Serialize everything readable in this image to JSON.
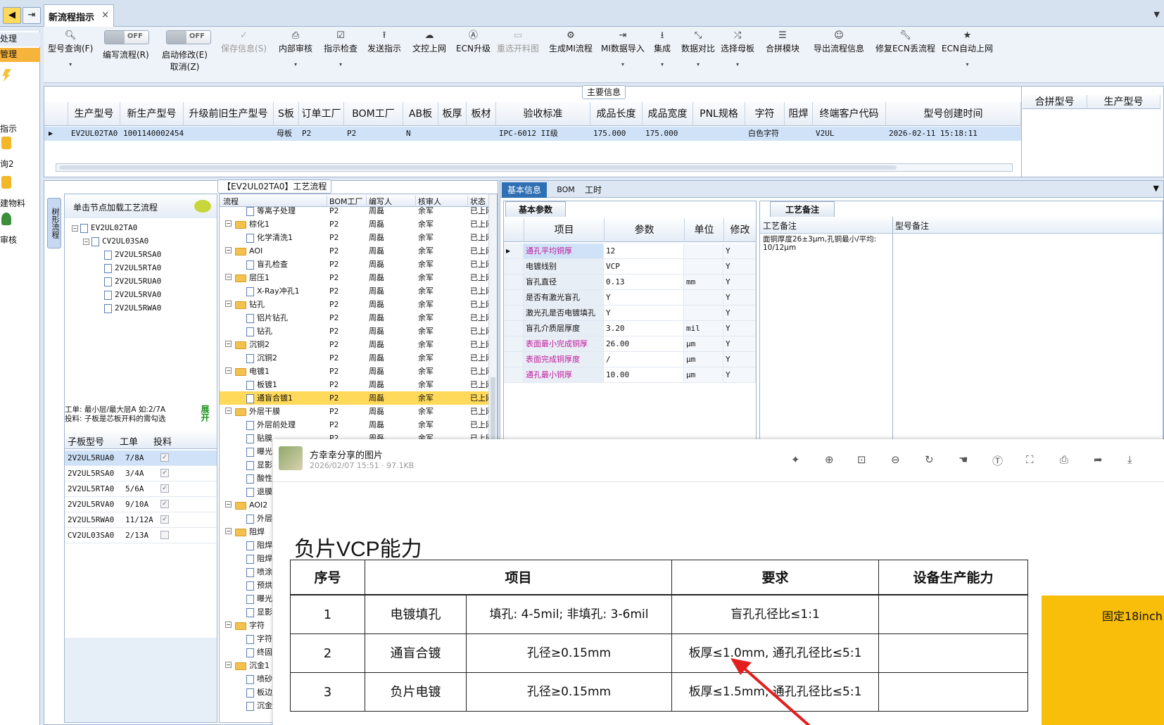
{
  "window": {
    "tab_title": "新流程指示",
    "tab_close": "×",
    "right_arrow": "▼"
  },
  "nav": {
    "back": "◀",
    "forward": "⇥"
  },
  "left_nav": {
    "items": [
      "处理",
      "管理",
      "指示",
      "询2",
      "建物料",
      "审核"
    ]
  },
  "toolbar": {
    "items": [
      {
        "label": "型号查询(F)",
        "icon": "🔍︎",
        "dropdown": "▾"
      },
      {
        "label": "编写流程(R)"
      },
      {
        "label": "启动修改(E)",
        "label2": "取消(Z)"
      },
      {
        "label": "保存信息(S)",
        "icon": "✓"
      },
      {
        "label": "内部审核",
        "icon": "⎙",
        "dropdown": "▾"
      },
      {
        "label": "指示检查",
        "icon": "☑",
        "dropdown": "▾"
      },
      {
        "label": "发送指示",
        "icon": "⭱"
      },
      {
        "label": "文控上网",
        "icon": "☁"
      },
      {
        "label": "ECN升级",
        "icon": "Ⓐ"
      },
      {
        "label": "重选开料图",
        "icon": "▭"
      },
      {
        "label": "生成MI流程",
        "icon": "⚙"
      },
      {
        "label": "MI数据导入",
        "icon": "⇥",
        "dropdown": "▾"
      },
      {
        "label": "集成",
        "icon": "⭳",
        "dropdown": "▾"
      },
      {
        "label": "数据对比",
        "icon": "⤡",
        "dropdown": "▾"
      },
      {
        "label": "选择母板",
        "icon": "⤮",
        "dropdown": "▾"
      },
      {
        "label": "合拼模块",
        "icon": "☰"
      },
      {
        "label": "导出流程信息",
        "icon": "☺"
      },
      {
        "label": "修复ECN丢流程",
        "icon": "🔧︎"
      },
      {
        "label": "ECN自动上网",
        "icon": "★",
        "dropdown": "▾"
      }
    ],
    "toggle_off": "OFF"
  },
  "main_info": {
    "title": "主要信息",
    "headers": [
      "生产型号",
      "新生产型号",
      "升级前旧生产型号",
      "S板",
      "订单工厂",
      "BOM工厂",
      "AB板",
      "板厚",
      "板材",
      "验收标准",
      "成品长度",
      "成品宽度",
      "PNL规格",
      "字符",
      "阻焊",
      "终端客户代码",
      "型号创建时间"
    ],
    "row": [
      "EV2UL02TA0",
      "10011400024549",
      "",
      "母板",
      "P2",
      "P2",
      "N",
      "",
      "",
      "IPC-6012 II级",
      "175.000",
      "175.000",
      "",
      "白色字符",
      "",
      "V2UL",
      "2026-02-11 15:18:11"
    ],
    "side_headers": [
      "合拼型号",
      "生产型号"
    ]
  },
  "process": {
    "title": "【EV2UL02TA0】工艺流程",
    "vertical_tab": "树形流程",
    "tree_header": "单击节点加载工艺流程",
    "tree": [
      "EV2UL02TA0",
      "CV2UL03SA0",
      "2V2UL5RSA0",
      "2V2UL5RTA0",
      "2V2UL5RUA0",
      "2V2UL5RVA0",
      "2V2UL5RWA0"
    ],
    "note1": "工单: 最小层/最大层A 如:2/7A",
    "note2": "投料: 子板是芯板开料的需勾选",
    "expand_btn": "展开",
    "sub_headers": [
      "子板型号",
      "工单",
      "投料"
    ],
    "sub_rows": [
      [
        "2V2UL5RUA0",
        "7/8A",
        true
      ],
      [
        "2V2UL5RSA0",
        "3/4A",
        true
      ],
      [
        "2V2UL5RTA0",
        "5/6A",
        true
      ],
      [
        "2V2UL5RVA0",
        "9/10A",
        true
      ],
      [
        "2V2UL5RWA0",
        "11/12A",
        true
      ],
      [
        "CV2UL03SA0",
        "2/13A",
        false
      ]
    ],
    "flow_headers": [
      "流程",
      "BOM工厂",
      "编写人",
      "核审人",
      "状态"
    ],
    "flow_rows": [
      {
        "name": "等离子处理",
        "level": 1,
        "folder": false
      },
      {
        "name": "棕化1",
        "level": 0,
        "folder": true
      },
      {
        "name": "化学清洗1",
        "level": 1,
        "folder": false
      },
      {
        "name": "AOI",
        "level": 0,
        "folder": true
      },
      {
        "name": "盲孔检查",
        "level": 1,
        "folder": false
      },
      {
        "name": "层压1",
        "level": 0,
        "folder": true
      },
      {
        "name": "X-Ray冲孔1",
        "level": 1,
        "folder": false
      },
      {
        "name": "钻孔",
        "level": 0,
        "folder": true
      },
      {
        "name": "铝片钻孔",
        "level": 1,
        "folder": false
      },
      {
        "name": "钻孔",
        "level": 1,
        "folder": false
      },
      {
        "name": "沉铜2",
        "level": 0,
        "folder": true
      },
      {
        "name": "沉铜2",
        "level": 1,
        "folder": false
      },
      {
        "name": "电镀1",
        "level": 0,
        "folder": true
      },
      {
        "name": "板镀1",
        "level": 1,
        "folder": false
      },
      {
        "name": "通盲合镀1",
        "level": 1,
        "folder": false,
        "selected": true
      },
      {
        "name": "外层干膜",
        "level": 0,
        "folder": true
      },
      {
        "name": "外层前处理",
        "level": 1,
        "folder": false
      },
      {
        "name": "贴膜",
        "level": 1,
        "folder": false
      },
      {
        "name": "曝光",
        "level": 1,
        "folder": false
      },
      {
        "name": "显影",
        "level": 1,
        "folder": false
      },
      {
        "name": "酸性",
        "level": 1,
        "folder": false
      },
      {
        "name": "退膜",
        "level": 1,
        "folder": false
      },
      {
        "name": "AOI2",
        "level": 0,
        "folder": true
      },
      {
        "name": "外层",
        "level": 1,
        "folder": false
      },
      {
        "name": "阻焊",
        "level": 0,
        "folder": true
      },
      {
        "name": "阻焊",
        "level": 1,
        "folder": false
      },
      {
        "name": "阻焊",
        "level": 1,
        "folder": false
      },
      {
        "name": "喷涂",
        "level": 1,
        "folder": false
      },
      {
        "name": "预烘",
        "level": 1,
        "folder": false
      },
      {
        "name": "曝光",
        "level": 1,
        "folder": false
      },
      {
        "name": "显影",
        "level": 1,
        "folder": false
      },
      {
        "name": "字符",
        "level": 0,
        "folder": true
      },
      {
        "name": "字符",
        "level": 1,
        "folder": false
      },
      {
        "name": "终固",
        "level": 1,
        "folder": false
      },
      {
        "name": "沉金1",
        "level": 0,
        "folder": true
      },
      {
        "name": "喷砂",
        "level": 1,
        "folder": false
      },
      {
        "name": "板边",
        "level": 1,
        "folder": false
      },
      {
        "name": "沉金",
        "level": 1,
        "folder": false
      }
    ],
    "flow_factory": "P2",
    "flow_writer": "周磊",
    "flow_reviewer": "余军",
    "flow_status": "已上网"
  },
  "right_tabs": [
    "基本信息",
    "BOM",
    "工时"
  ],
  "basic_params": {
    "tab": "基本参数",
    "headers": [
      "项目",
      "参数",
      "单位",
      "修改"
    ],
    "rows": [
      [
        "通孔平均铜厚",
        "12",
        "",
        "Y",
        true
      ],
      [
        "电镀线别",
        "VCP",
        "",
        "Y",
        false
      ],
      [
        "盲孔直径",
        "0.13",
        "mm",
        "Y",
        false
      ],
      [
        "是否有激光盲孔",
        "Y",
        "",
        "Y",
        false
      ],
      [
        "激光孔是否电镀填孔",
        "Y",
        "",
        "Y",
        false
      ],
      [
        "盲孔介质层厚度",
        "3.20",
        "mil",
        "Y",
        false
      ],
      [
        "表面最小完成铜厚",
        "26.00",
        "μm",
        "Y",
        true
      ],
      [
        "表面完成铜厚度",
        "/",
        "μm",
        "Y",
        true
      ],
      [
        "通孔最小铜厚",
        "10.00",
        "μm",
        "Y",
        true
      ]
    ]
  },
  "process_notes": {
    "tab": "工艺备注",
    "headers": [
      "工艺备注",
      "型号备注"
    ],
    "note": "面铜厚度26±3μm,孔铜最小/平均: 10/12μm"
  },
  "image_viewer": {
    "title": "方幸幸分享的图片",
    "meta": "2026/02/07 15:51 · 97.1KB",
    "doc_title": "负片VCP能力",
    "table_headers": [
      "序号",
      "项目",
      "要求",
      "设备生产能力"
    ],
    "rows": [
      [
        "1",
        "电镀填孔",
        "填孔: 4-5mil; 非填孔: 3-6mil",
        "盲孔孔径比≤1:1",
        ""
      ],
      [
        "2",
        "通盲合镀",
        "孔径≥0.15mm",
        "板厚≤1.0mm, 通孔孔径比≤5:1",
        ""
      ],
      [
        "3",
        "负片电镀",
        "孔径≥0.15mm",
        "板厚≤1.5mm, 通孔孔径比≤5:1",
        ""
      ]
    ],
    "side_note": "固定18inch"
  },
  "colors": {
    "accent": "#2f6fb3",
    "selection": "#ffd95a",
    "param_highlight": "#c2189a",
    "orange": "#f9be0a"
  }
}
